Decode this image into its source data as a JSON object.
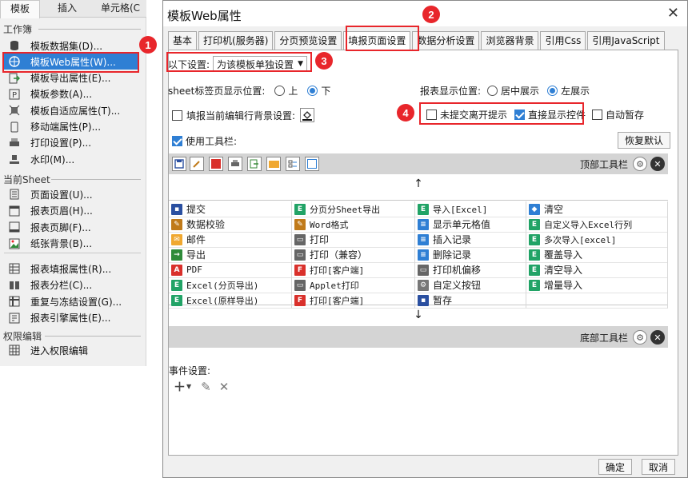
{
  "left": {
    "tabs": [
      "模板",
      "插入",
      "单元格(C"
    ],
    "section_workbook": "工作簿",
    "workbook_items": [
      {
        "label": "模板数据集(D)...",
        "icon": "database-icon"
      },
      {
        "label": "模板Web属性(W)...",
        "icon": "globe-settings-icon"
      },
      {
        "label": "模板导出属性(E)...",
        "icon": "export-icon"
      },
      {
        "label": "模板参数(A)...",
        "icon": "parameter-icon"
      },
      {
        "label": "模板自适应属性(T)...",
        "icon": "adaptive-icon"
      },
      {
        "label": "移动端属性(P)...",
        "icon": "mobile-icon"
      },
      {
        "label": "打印设置(P)...",
        "icon": "printer-icon"
      },
      {
        "label": "水印(M)...",
        "icon": "watermark-icon"
      }
    ],
    "section_sheet": "当前Sheet",
    "sheet_items": [
      {
        "label": "页面设置(U)...",
        "icon": "page-setup-icon"
      },
      {
        "label": "报表页眉(H)...",
        "icon": "header-icon"
      },
      {
        "label": "报表页脚(F)...",
        "icon": "footer-icon"
      },
      {
        "label": "纸张背景(B)...",
        "icon": "background-image-icon"
      },
      {
        "label": "报表填报属性(R)...",
        "icon": "fill-property-icon"
      },
      {
        "label": "报表分栏(C)...",
        "icon": "columns-icon"
      },
      {
        "label": "重复与冻结设置(G)...",
        "icon": "freeze-icon"
      },
      {
        "label": "报表引擎属性(E)...",
        "icon": "engine-icon"
      }
    ],
    "section_permission": "权限编辑",
    "permission_items": [
      {
        "label": "进入权限编辑",
        "icon": "permission-icon"
      }
    ]
  },
  "dialog": {
    "title": "模板Web属性",
    "close": "✕",
    "tabs": [
      "基本",
      "打印机(服务器)",
      "分页预览设置",
      "填报页面设置",
      "数据分析设置",
      "浏览器背景",
      "引用Css",
      "引用JavaScript"
    ],
    "active_tab": 3,
    "settings_label": "以下设置:",
    "settings_value": "为该模板单独设置",
    "sheet_tab_label": "sheet标签页显示位置:",
    "sheet_tab_options": [
      "上",
      "下"
    ],
    "report_pos_label": "报表显示位置:",
    "report_pos_options": [
      "居中展示",
      "左展示"
    ],
    "fill_bg_label": "填报当前编辑行背景设置:",
    "unsubmitted_label": "未提交离开提示",
    "direct_show_label": "直接显示控件",
    "auto_save_label": "自动暂存",
    "use_toolbar_label": "使用工具栏:",
    "restore_default": "恢复默认",
    "top_toolbar_label": "顶部工具栏",
    "bottom_toolbar_label": "底部工具栏",
    "up_arrow": "↑",
    "down_arrow": "↓",
    "event_label": "事件设置:",
    "ok": "确定",
    "cancel": "取消"
  },
  "toolbar_items": [
    [
      "提交",
      "分页分Sheet导出",
      "导入[Excel]",
      "清空"
    ],
    [
      "数据校验",
      "Word格式",
      "显示单元格值",
      "自定义导入Excel行列"
    ],
    [
      "邮件",
      "打印",
      "插入记录",
      "多次导入[excel]"
    ],
    [
      "导出",
      "打印（兼容）",
      "删除记录",
      "覆盖导入"
    ],
    [
      "PDF",
      "打印[客户端]",
      "打印机偏移",
      "清空导入"
    ],
    [
      "Excel(分页导出)",
      "Applet打印",
      "自定义按钮",
      "增量导入"
    ],
    [
      "Excel(原样导出)",
      "打印[客户端]",
      "暂存",
      ""
    ]
  ],
  "callouts": [
    "1",
    "2",
    "3",
    "4"
  ],
  "colors": {
    "accent": "#2f7fd4",
    "callout": "#e8262b",
    "excel_green": "#21a366",
    "pdf_red": "#d9302b"
  }
}
